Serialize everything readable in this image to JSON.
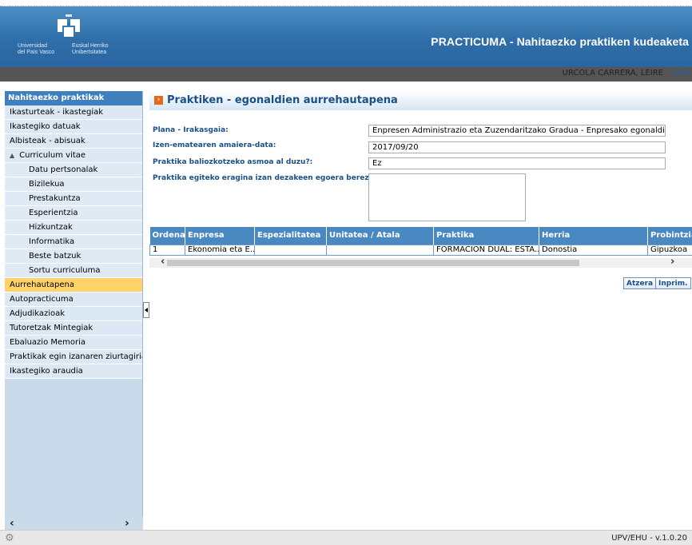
{
  "header": {
    "logo_left_line1": "Universidad",
    "logo_left_line2": "del País Vasco",
    "logo_right_line1": "Euskal Herriko",
    "logo_right_line2": "Unibertsitatea",
    "app_title": "PRACTICUMA - Nahitaezko praktiken kudeaketa"
  },
  "user": {
    "name": "URCOLA CARRERA, LEIRE",
    "exit": "Irten"
  },
  "sidebar": {
    "header": "Nahitaezko praktikak",
    "items": [
      {
        "label": "Ikasturteak - ikastegiak"
      },
      {
        "label": "Ikastegiko datuak"
      },
      {
        "label": "Albisteak - abisuak"
      },
      {
        "label": "Curriculum vitae"
      },
      {
        "label": "Datu pertsonalak"
      },
      {
        "label": "Bizilekua"
      },
      {
        "label": "Prestakuntza"
      },
      {
        "label": "Esperientzia"
      },
      {
        "label": "Hizkuntzak"
      },
      {
        "label": "Informatika"
      },
      {
        "label": "Beste batzuk"
      },
      {
        "label": "Sortu curriculuma"
      },
      {
        "label": "Aurrehautapena"
      },
      {
        "label": "Autopracticuma"
      },
      {
        "label": "Adjudikazioak"
      },
      {
        "label": "Tutoretzak Mintegiak"
      },
      {
        "label": "Ebaluazio Memoria"
      },
      {
        "label": "Praktikak egin izanaren ziurtagiria"
      },
      {
        "label": "Ikastegiko araudia"
      }
    ]
  },
  "main": {
    "title": "Praktiken - egonaldien aurrehautapena",
    "fields": {
      "plana_label": "Plana - Irakasgaia:",
      "plana_value": "Enpresen Administrazio eta Zuzendaritzako Gradua - Enpresako egonaldia I",
      "data_label": "Izen-ematearen amaiera-data:",
      "data_value": "2017/09/20",
      "asmoa_label": "Praktika baliozkotzeko asmoa al duzu?:",
      "asmoa_value": "Ez",
      "egoera_label": "Praktika egiteko eragina izan dezakeen egoera berezia:",
      "egoera_value": ""
    },
    "table": {
      "headers": [
        "Ordena",
        "Enpresa",
        "Espezialitatea",
        "Unitatea / Atala",
        "Praktika",
        "Herria",
        "Probintzia"
      ],
      "rows": [
        [
          "1",
          "Ekonomia eta E...",
          "",
          "",
          "FORMACIÓN DUAL: ESTA...",
          "Donostia",
          "Gipuzkoa"
        ]
      ]
    },
    "buttons": {
      "back": "Atzera",
      "print": "Inprim."
    }
  },
  "footer": {
    "version": "UPV/EHU - v.1.0.20"
  }
}
